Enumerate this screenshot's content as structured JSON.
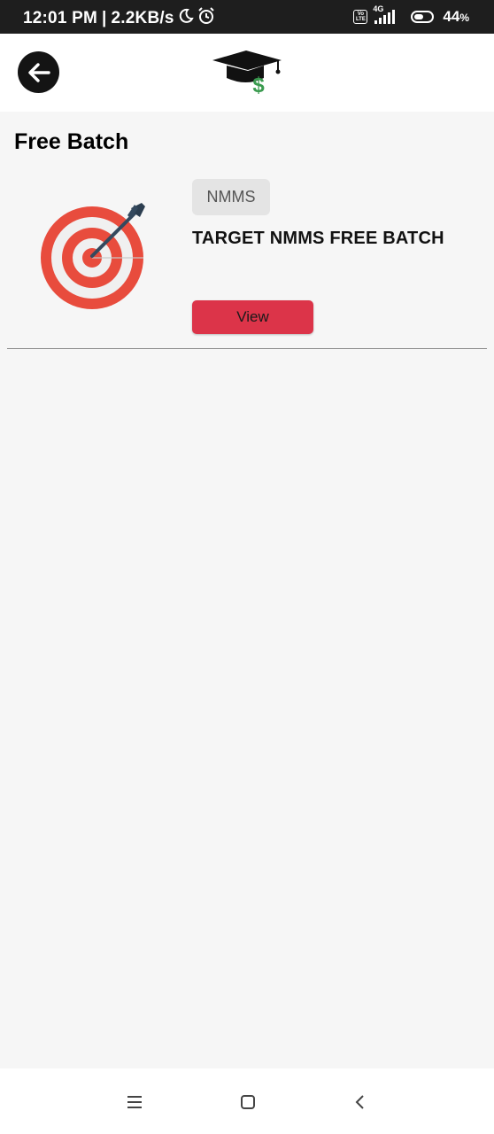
{
  "status_bar": {
    "time": "12:01 PM",
    "separator": "|",
    "speed": "2.2KB/s",
    "network_label": "4G",
    "volte_label": "Vo LTE",
    "battery": "44",
    "battery_unit": "%"
  },
  "header": {
    "back_icon": "arrow-left-icon",
    "logo": "graduation-cap-dollar-logo"
  },
  "page": {
    "title": "Free Batch"
  },
  "batches": [
    {
      "category": "NMMS",
      "title": "TARGET NMMS FREE BATCH",
      "view_label": "View",
      "image": "target-dart-icon"
    }
  ],
  "nav_bar": {
    "icons": [
      "menu-icon",
      "home-square-icon",
      "back-chevron-icon"
    ]
  },
  "colors": {
    "accent": "#dc3449",
    "header_bg": "#ffffff",
    "page_bg": "#f6f6f6",
    "status_bg": "#1e1e1e"
  }
}
